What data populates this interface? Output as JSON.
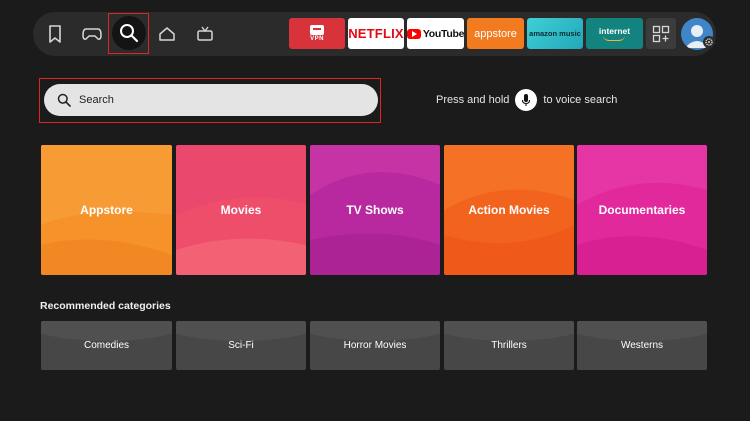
{
  "nav": {
    "icons": [
      "bookmark-icon",
      "gamepad-icon",
      "search-icon",
      "home-icon",
      "tv-icon"
    ],
    "active": "search"
  },
  "apps": {
    "vpn": "VPN",
    "netflix": "NETFLIX",
    "youtube": "YouTube",
    "appstore": "appstore",
    "amazon_music": "amazon music",
    "internet": "internet",
    "all_apps_icon": "apps-grid-icon"
  },
  "profile": {
    "avatar_icon": "user-avatar-icon",
    "settings_icon": "gear-icon"
  },
  "search": {
    "placeholder": "Search",
    "voice_hint_before": "Press and hold",
    "voice_hint_after": "to voice search"
  },
  "categories": [
    {
      "label": "Appstore",
      "color": "#f5932a"
    },
    {
      "label": "Movies",
      "color": "#ee4e6a"
    },
    {
      "label": "TV Shows",
      "color": "#b8289e"
    },
    {
      "label": "Action Movies",
      "color": "#f2641e"
    },
    {
      "label": "Documentaries",
      "color": "#e2299c"
    }
  ],
  "recommended": {
    "title": "Recommended categories",
    "items": [
      "Comedies",
      "Sci-Fi",
      "Horror Movies",
      "Thrillers",
      "Westerns"
    ]
  },
  "colors": {
    "focus": "#e02424",
    "background": "#1b1b1b"
  }
}
